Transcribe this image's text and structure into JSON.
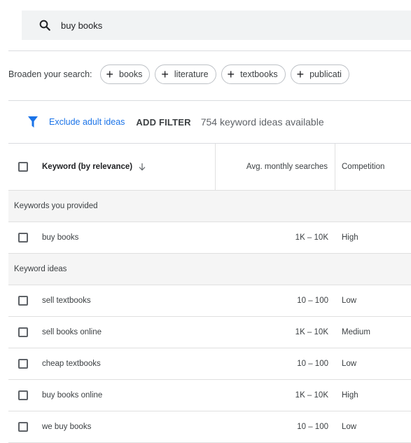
{
  "search": {
    "query": "buy books"
  },
  "broaden": {
    "label": "Broaden your search:",
    "chips": [
      "books",
      "literature",
      "textbooks",
      "publicati"
    ]
  },
  "filters": {
    "exclude_label": "Exclude adult ideas",
    "add_filter_label": "ADD FILTER",
    "count_text": "754 keyword ideas available"
  },
  "table": {
    "headers": {
      "keyword": "Keyword (by relevance)",
      "avg": "Avg. monthly searches",
      "competition": "Competition"
    },
    "sections": [
      {
        "title": "Keywords you provided",
        "rows": [
          {
            "keyword": "buy books",
            "avg": "1K – 10K",
            "competition": "High"
          }
        ]
      },
      {
        "title": "Keyword ideas",
        "rows": [
          {
            "keyword": "sell textbooks",
            "avg": "10 – 100",
            "competition": "Low"
          },
          {
            "keyword": "sell books online",
            "avg": "1K – 10K",
            "competition": "Medium"
          },
          {
            "keyword": "cheap textbooks",
            "avg": "10 – 100",
            "competition": "Low"
          },
          {
            "keyword": "buy books online",
            "avg": "1K – 10K",
            "competition": "High"
          },
          {
            "keyword": "we buy books",
            "avg": "10 – 100",
            "competition": "Low"
          }
        ]
      }
    ]
  },
  "colors": {
    "accent": "#1a73e8",
    "searchbar_bg": "#f1f3f4",
    "section_bg": "#f5f5f5"
  },
  "icons": {
    "search": "search-icon",
    "filter": "funnel-icon",
    "sort": "arrow-down-icon",
    "chip": "plus-icon"
  }
}
